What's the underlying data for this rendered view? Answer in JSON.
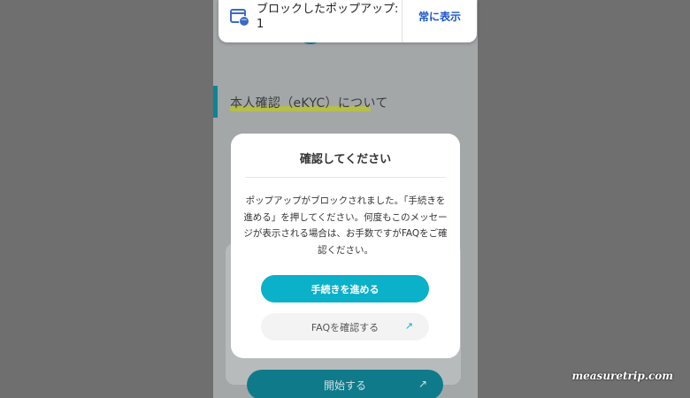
{
  "notification": {
    "message": "ブロックしたポップアップ: 1",
    "always_show": "常に表示",
    "icon": "popup-blocked-icon"
  },
  "page": {
    "section_title": "本人確認（eKYC）について",
    "start_button": "開始する",
    "start_icon": "external-arrow-icon"
  },
  "modal": {
    "title": "確認してください",
    "body": "ポップアップがブロックされました。「手続きを進める」を押してください。何度もこのメッセージが表示される場合は、お手数ですがFAQをご確認ください。",
    "primary_button": "手続きを進める",
    "secondary_button": "FAQを確認する",
    "secondary_icon": "external-arrow-icon"
  },
  "watermark": "measuretrip.com",
  "colors": {
    "accent": "#0bb0c9",
    "link": "#1a56c8",
    "overlay": "#6f6f6f"
  }
}
